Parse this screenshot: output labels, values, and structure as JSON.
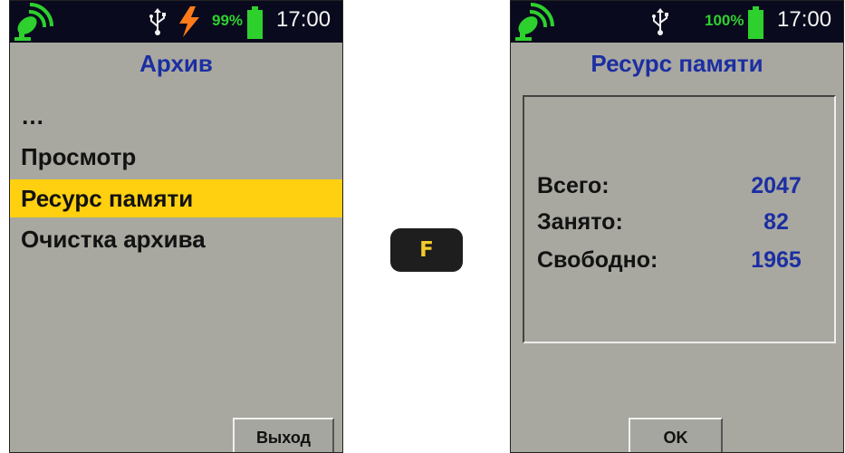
{
  "left_screen": {
    "status": {
      "battery_percent": "99%",
      "battery_level": 0.99,
      "time": "17:00",
      "icons": [
        "satellite-icon",
        "usb-icon",
        "charging-bolt-icon",
        "battery-icon"
      ]
    },
    "title": "Архив",
    "menu": [
      {
        "label": "…",
        "selected": false
      },
      {
        "label": "Просмотр",
        "selected": false
      },
      {
        "label": "Ресурс памяти",
        "selected": true
      },
      {
        "label": "Очистка архива",
        "selected": false
      }
    ],
    "exit_button": "Выход",
    "selected_color": "#ffd010"
  },
  "key": {
    "label": "F"
  },
  "right_screen": {
    "status": {
      "battery_percent": "100%",
      "battery_level": 1.0,
      "time": "17:00",
      "icons": [
        "satellite-icon",
        "usb-icon",
        "battery-icon"
      ]
    },
    "title": "Ресурс памяти",
    "stats": [
      {
        "label": "Всего:",
        "value": "2047"
      },
      {
        "label": "Занято:",
        "value": "82"
      },
      {
        "label": "Свободно:",
        "value": "1965"
      }
    ],
    "ok_button": "OK"
  },
  "colors": {
    "background": "#a8a8a0",
    "status_bar": "#0a0a1e",
    "title": "#1c2ea2",
    "battery": "#2ed02e",
    "bolt": "#ff7a1a",
    "key_text": "#f2cc2a"
  }
}
